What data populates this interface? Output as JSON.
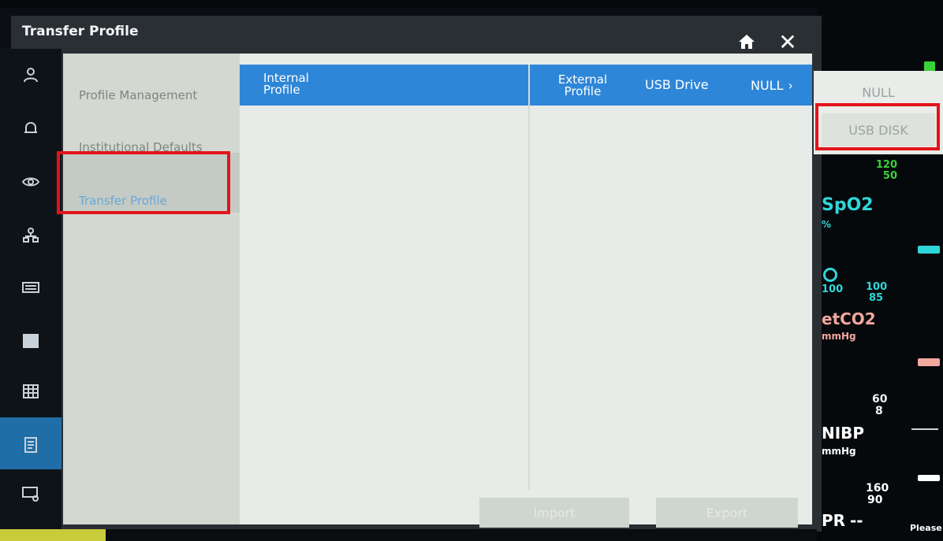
{
  "dialog": {
    "title": "Transfer Profile"
  },
  "nav": {
    "items": [
      "Profile Management",
      "Institutional Defaults",
      "Transfer Profile"
    ],
    "selected_index": 2
  },
  "table": {
    "internal_profile_label": "Internal\nProfile",
    "external_profile_label": "External\nProfile",
    "drive_label": "USB Drive",
    "drive_value": "NULL"
  },
  "dropdown": {
    "options": [
      "NULL",
      "USB DISK"
    ]
  },
  "footer": {
    "import_label": "Import",
    "export_label": "Export"
  },
  "monitor": {
    "spo2_label": "SpO2",
    "spo2_unit": "%",
    "spo2_upper": "120",
    "spo2_lower": "50",
    "o2_value": "100",
    "limit_upper": "100",
    "limit_lower": "85",
    "etco2_label": "etCO2",
    "etco2_unit": "mmHg",
    "etco2_upper": "60",
    "etco2_lower": "8",
    "nibp_label": "NIBP",
    "nibp_unit": "mmHg",
    "nibp_upper": "160",
    "nibp_lower": "90",
    "pr_label": "PR",
    "pr_value": "--",
    "status_text": "Please"
  },
  "colors": {
    "header_blue": "#2e86d8",
    "sidebar_active": "#1f6ea8",
    "annotation_red": "#e3141b",
    "spo2_cyan": "#2fd6d9",
    "etco2_salmon": "#f2a79d",
    "limit_green": "#39d23a"
  },
  "icons": [
    "person-icon",
    "bell-icon",
    "eye-icon",
    "network-icon",
    "keyboard-icon",
    "columns-icon",
    "grid-icon",
    "document-icon",
    "monitor-settings-icon",
    "home-icon",
    "close-icon",
    "chevron-right-icon"
  ]
}
